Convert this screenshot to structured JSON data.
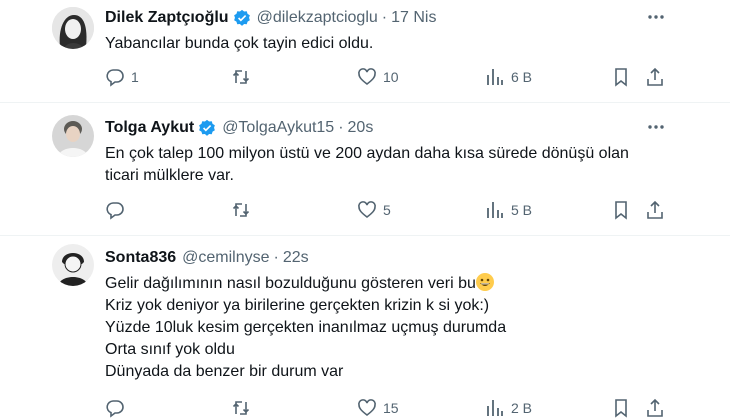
{
  "colors": {
    "verified": "#1d9bf0",
    "muted": "#536471",
    "text": "#0f1419",
    "divider": "#eff3f4"
  },
  "tweets": [
    {
      "name": "Dilek Zaptçıoğlu",
      "verified": true,
      "handle": "@dilekzaptcioglu",
      "separator": "·",
      "time": "17 Nis",
      "lines": [
        "Yabancılar bunda çok tayin edici oldu."
      ],
      "replies": "1",
      "retweets": "",
      "likes": "10",
      "views": "6 B"
    },
    {
      "name": "Tolga Aykut",
      "verified": true,
      "handle": "@TolgaAykut15",
      "separator": "·",
      "time": "20s",
      "lines": [
        "En çok talep 100 milyon üstü ve 200 aydan daha kısa sürede dönüşü olan",
        "ticari mülklere var."
      ],
      "replies": "",
      "retweets": "",
      "likes": "5",
      "views": "5 B"
    },
    {
      "name": "Sonta836",
      "verified": false,
      "handle": "@cemilnyse",
      "separator": "·",
      "time": "22s",
      "lines": [
        "Gelir dağılımının nasıl bozulduğunu gösteren veri bu",
        "Kriz yok deniyor ya birilerine gerçekten  krizin k si yok:)",
        "Yüzde 10luk kesim gerçekten inanılmaz uçmuş durumda",
        "Orta sınıf yok oldu",
        "Dünyada da benzer bir durum var"
      ],
      "emoji": "grinning-face-emoji",
      "replies": "",
      "retweets": "",
      "likes": "15",
      "views": "2 B"
    }
  ]
}
